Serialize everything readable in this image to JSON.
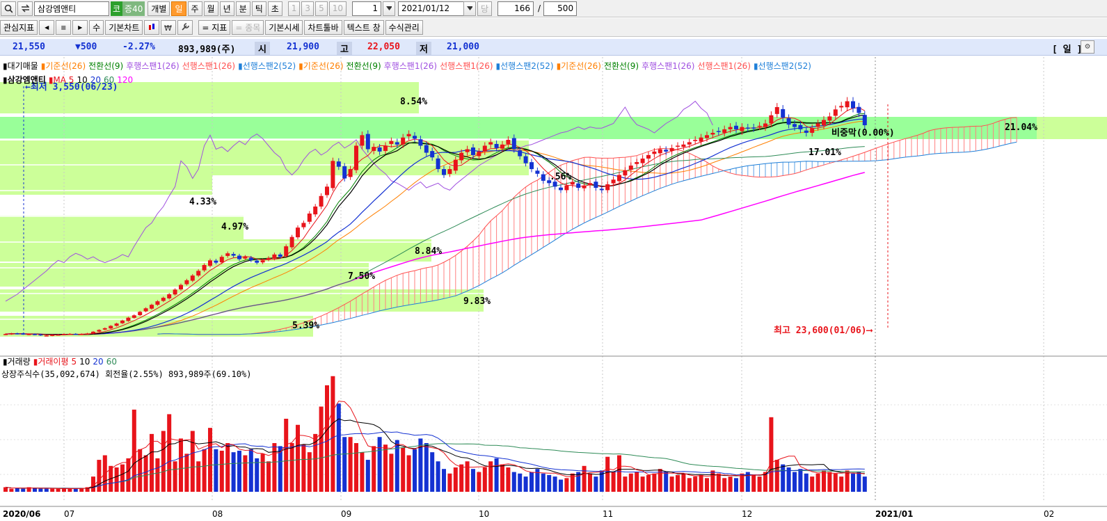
{
  "toolbar1": {
    "stock_name": "삼강엠앤티",
    "market_badge": "코",
    "margin_badge": "증40",
    "individual": "개별",
    "periods": [
      "일",
      "주",
      "월",
      "년",
      "분",
      "틱",
      "초"
    ],
    "minute_presets": [
      "1",
      "3",
      "5",
      "10"
    ],
    "unit_value": "1",
    "date": "2021/01/12",
    "today_btn": "당",
    "display_count": "166",
    "separator": "/",
    "total_count": "500"
  },
  "toolbar2": {
    "watchlist": "관심지표",
    "nav_prev": "◀",
    "nav_stop": "■",
    "nav_next": "▶",
    "modify": "수",
    "basic_chart": "기본차트",
    "indicator": "= 지표",
    "item": "= 종목",
    "basic_quote": "기본시세",
    "chart_toolbar": "차트툴바",
    "text_window": "텍스트 창",
    "formula_manage": "수식관리"
  },
  "quote": {
    "price": "21,550",
    "change": "▼500",
    "change_pct": "-2.27%",
    "volume": "893,989(주)",
    "open_label": "시",
    "open": "21,900",
    "high_label": "고",
    "high": "22,050",
    "low_label": "저",
    "low": "21,000",
    "period_label": "[ 일 ]"
  },
  "legend_top": [
    {
      "text": "▮대기매물",
      "color": "#000000"
    },
    {
      "text": "▮기준선(26)",
      "color": "#ff7f00"
    },
    {
      "text": "전환선(9)",
      "color": "#008000"
    },
    {
      "text": "후행스팬1(26)",
      "color": "#a050e0"
    },
    {
      "text": "선행스팬1(26)",
      "color": "#ff5050"
    },
    {
      "text": "▮선행스팬2(52)",
      "color": "#1e7fd8"
    },
    {
      "text": "▮기준선(26)",
      "color": "#ff7f00"
    },
    {
      "text": "전환선(9)",
      "color": "#008000"
    },
    {
      "text": "후행스팬1(26)",
      "color": "#a050e0"
    },
    {
      "text": "선행스팬1(26)",
      "color": "#ff5050"
    },
    {
      "text": "▮선행스팬2(52)",
      "color": "#1e7fd8"
    },
    {
      "text": "▮기준선(26)",
      "color": "#ff7f00"
    },
    {
      "text": "전환선(9)",
      "color": "#008000"
    },
    {
      "text": "후행스팬1(26)",
      "color": "#a050e0"
    },
    {
      "text": "선행스팬1(26)",
      "color": "#ff5050"
    },
    {
      "text": "▮선행스팬2(52)",
      "color": "#1e7fd8"
    }
  ],
  "legend_ma": {
    "name": "▮삼강엠앤티",
    "ma": "▮MA 5",
    "p10": "10",
    "p20": "20",
    "p60": "60",
    "p120": "120"
  },
  "annotations": {
    "low": "←최저 3,550(06/23)",
    "high": "최고 23,600(01/06)⟶",
    "pcts": [
      "8.54%",
      "4.33%",
      "4.97%",
      "8.84%",
      "7.50%",
      "9.83%",
      "5.39%",
      "21.04%",
      "17.01%",
      "비중막(0.00%)",
      ".56%"
    ]
  },
  "volume_legend": {
    "title": "▮거래량",
    "ma": "▮거래이평",
    "p5": "5",
    "p10": "10",
    "p20": "20",
    "p60": "60",
    "info": "상장주식수(35,092,674) 회전율(2.55%) 893,989주(69.10%)"
  },
  "x_axis": [
    "2020/06",
    "07",
    "08",
    "09",
    "10",
    "11",
    "12",
    "2021/01",
    "02"
  ],
  "colors": {
    "up": "#e8141b",
    "down": "#1432d2",
    "band": "#ccff99",
    "band_strong": "#99ff99",
    "ma5": "#e8141b",
    "ma10": "#000000",
    "ma20": "#1432d2",
    "ma60": "#2e8b57",
    "ma120": "#ff00ff"
  },
  "chart_data": {
    "type": "candlestick",
    "title": "삼강엠앤티",
    "x_start": "2020/06",
    "x_end": "2021/01",
    "ylim": [
      3000,
      25000
    ],
    "closes": [
      3700,
      3750,
      3720,
      3680,
      3700,
      3650,
      3600,
      3580,
      3620,
      3650,
      3700,
      3720,
      3680,
      3700,
      3750,
      3900,
      4050,
      4200,
      4400,
      4600,
      4850,
      5100,
      5300,
      5600,
      5900,
      6200,
      6500,
      6800,
      7100,
      7500,
      7900,
      8300,
      8700,
      9100,
      9600,
      10000,
      9800,
      10300,
      10600,
      10400,
      10100,
      10300,
      10000,
      9800,
      10000,
      10200,
      10500,
      10300,
      11200,
      12000,
      12800,
      13200,
      14000,
      14600,
      15500,
      16300,
      18500,
      18000,
      17000,
      17800,
      19800,
      20700,
      19500,
      19700,
      19300,
      19800,
      20200,
      19900,
      20500,
      20800,
      20400,
      19800,
      19200,
      18800,
      17800,
      17300,
      17800,
      18600,
      19200,
      19500,
      19000,
      19300,
      19800,
      20100,
      19600,
      19900,
      20300,
      19500,
      18900,
      18300,
      17800,
      17400,
      16800,
      16600,
      16300,
      16000,
      16400,
      16700,
      16200,
      16400,
      16600,
      16200,
      16000,
      16500,
      16900,
      17300,
      17700,
      18100,
      18400,
      18700,
      19000,
      19300,
      19500,
      19300,
      19600,
      19800,
      19900,
      20100,
      20300,
      20500,
      20700,
      20900,
      21000,
      21200,
      21400,
      21200,
      21400,
      21300,
      21300,
      21500,
      21700,
      22400,
      23100,
      22200,
      21600,
      21400,
      21200,
      20900,
      21300,
      21700,
      22000,
      22300,
      22900,
      23200,
      23600,
      23000,
      22600,
      21550
    ],
    "volumes": [
      0.3,
      0.2,
      0.25,
      0.2,
      0.3,
      0.25,
      0.2,
      0.2,
      0.2,
      0.2,
      0.25,
      0.2,
      0.2,
      0.25,
      0.3,
      1.0,
      2.1,
      2.4,
      1.7,
      1.6,
      1.8,
      2.2,
      5.4,
      2.8,
      2.4,
      3.8,
      2.2,
      4.0,
      5.1,
      2.0,
      3.5,
      2.5,
      4.0,
      2.0,
      2.8,
      4.2,
      2.8,
      2.7,
      3.2,
      2.6,
      2.7,
      2.4,
      2.8,
      2.2,
      2.5,
      2.0,
      3.2,
      3.0,
      4.8,
      3.2,
      4.4,
      3.1,
      2.6,
      3.8,
      5.6,
      7.0,
      7.6,
      5.8,
      3.6,
      3.6,
      3.2,
      2.6,
      2.1,
      3.0,
      3.6,
      3.1,
      2.5,
      3.4,
      2.9,
      2.4,
      2.8,
      3.5,
      3.2,
      2.6,
      2.0,
      1.5,
      1.2,
      1.6,
      1.8,
      2.0,
      1.5,
      1.3,
      1.6,
      2.0,
      2.2,
      1.8,
      1.6,
      1.3,
      1.2,
      1.0,
      1.3,
      1.5,
      1.2,
      1.1,
      1.0,
      0.8,
      0.9,
      1.2,
      1.3,
      1.7,
      1.2,
      1.0,
      1.4,
      2.3,
      1.3,
      2.4,
      1.0,
      1.2,
      1.3,
      1.0,
      1.1,
      1.2,
      1.5,
      1.3,
      1.0,
      1.1,
      1.2,
      0.9,
      1.0,
      1.1,
      0.9,
      1.4,
      1.2,
      0.9,
      1.0,
      0.9,
      1.2,
      1.3,
      1.1,
      1.0,
      1.3,
      4.9,
      2.1,
      1.8,
      1.6,
      1.3,
      1.5,
      1.2,
      1.0,
      1.2,
      1.4,
      1.3,
      1.2,
      1.0,
      1.4,
      1.2,
      1.3,
      1.0
    ]
  }
}
